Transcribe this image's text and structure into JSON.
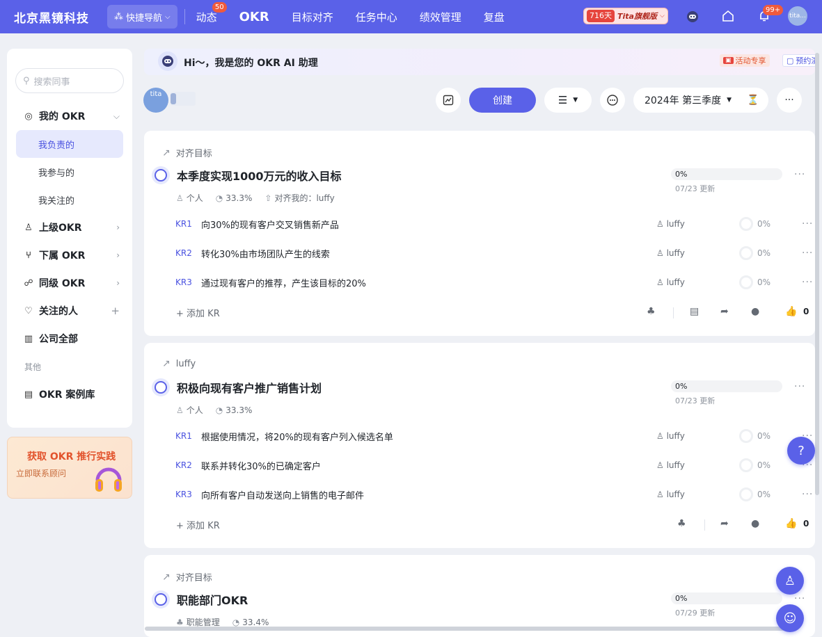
{
  "topbar": {
    "brand": "北京黑镜科技",
    "quicknav": "快捷导航",
    "nav": [
      {
        "label": "动态",
        "badge": "50"
      },
      {
        "label": "OKR",
        "active": true
      },
      {
        "label": "目标对齐"
      },
      {
        "label": "任务中心"
      },
      {
        "label": "绩效管理"
      },
      {
        "label": "复盘"
      }
    ],
    "trial_days": "716天",
    "trial_plan": "Tita旗舰版",
    "bell_badge": "99+",
    "avatar_text": "tita..."
  },
  "sidebar": {
    "search_placeholder": "搜索同事",
    "my_okr": "我的 OKR",
    "sub_items": [
      "我负责的",
      "我参与的",
      "我关注的"
    ],
    "superior_okr": "上级OKR",
    "subordinate_okr": "下属 OKR",
    "peer_okr": "同级 OKR",
    "followed": "关注的人",
    "company_all": "公司全部",
    "other_label": "其他",
    "case_library": "OKR 案例库"
  },
  "promo": {
    "title": "获取 OKR 推行实践",
    "subtitle": "立即联系顾问"
  },
  "ai_bar": {
    "greeting": "Hi～，我是您的 OKR AI 助理",
    "activity": "活动专享",
    "booking": "预约演示"
  },
  "toolbar": {
    "avatar_text": "tita",
    "create": "创建",
    "period": "2024年 第三季度"
  },
  "objectives": [
    {
      "align_label": "对齐目标",
      "title": "本季度实现1000万元的收入目标",
      "owner_type": "个人",
      "score": "33.3%",
      "aligned_to": "对齐我的：luffy",
      "progress": "0%",
      "updated": "07/23 更新",
      "krs": [
        {
          "code": "KR1",
          "text": "向30%的现有客户交叉销售新产品",
          "owner": "luffy",
          "progress": "0%"
        },
        {
          "code": "KR2",
          "text": "转化30%由市场团队产生的线索",
          "owner": "luffy",
          "progress": "0%"
        },
        {
          "code": "KR3",
          "text": "通过现有客户的推荐，产生该目标的20%",
          "owner": "luffy",
          "progress": "0%"
        }
      ],
      "add_kr": "添加 KR",
      "likes": "0"
    },
    {
      "align_label": "luffy",
      "title": "积极向现有客户推广销售计划",
      "owner_type": "个人",
      "score": "33.3%",
      "progress": "0%",
      "updated": "07/23 更新",
      "krs": [
        {
          "code": "KR1",
          "text": "根据使用情况，将20%的现有客户列入候选名单",
          "owner": "luffy",
          "progress": "0%"
        },
        {
          "code": "KR2",
          "text": "联系并转化30%的已确定客户",
          "owner": "luffy",
          "progress": "0%"
        },
        {
          "code": "KR3",
          "text": "向所有客户自动发送向上销售的电子邮件",
          "owner": "luffy",
          "progress": "0%"
        }
      ],
      "add_kr": "添加 KR",
      "likes": "0"
    },
    {
      "align_label": "对齐目标",
      "title": "职能部门OKR",
      "owner_type": "职能管理",
      "score": "33.4%",
      "progress": "0%",
      "updated": "07/29 更新"
    }
  ],
  "colors": {
    "primary": "#5a61e8",
    "badge": "#f05a3c",
    "kr_code": "#4a52e0"
  }
}
